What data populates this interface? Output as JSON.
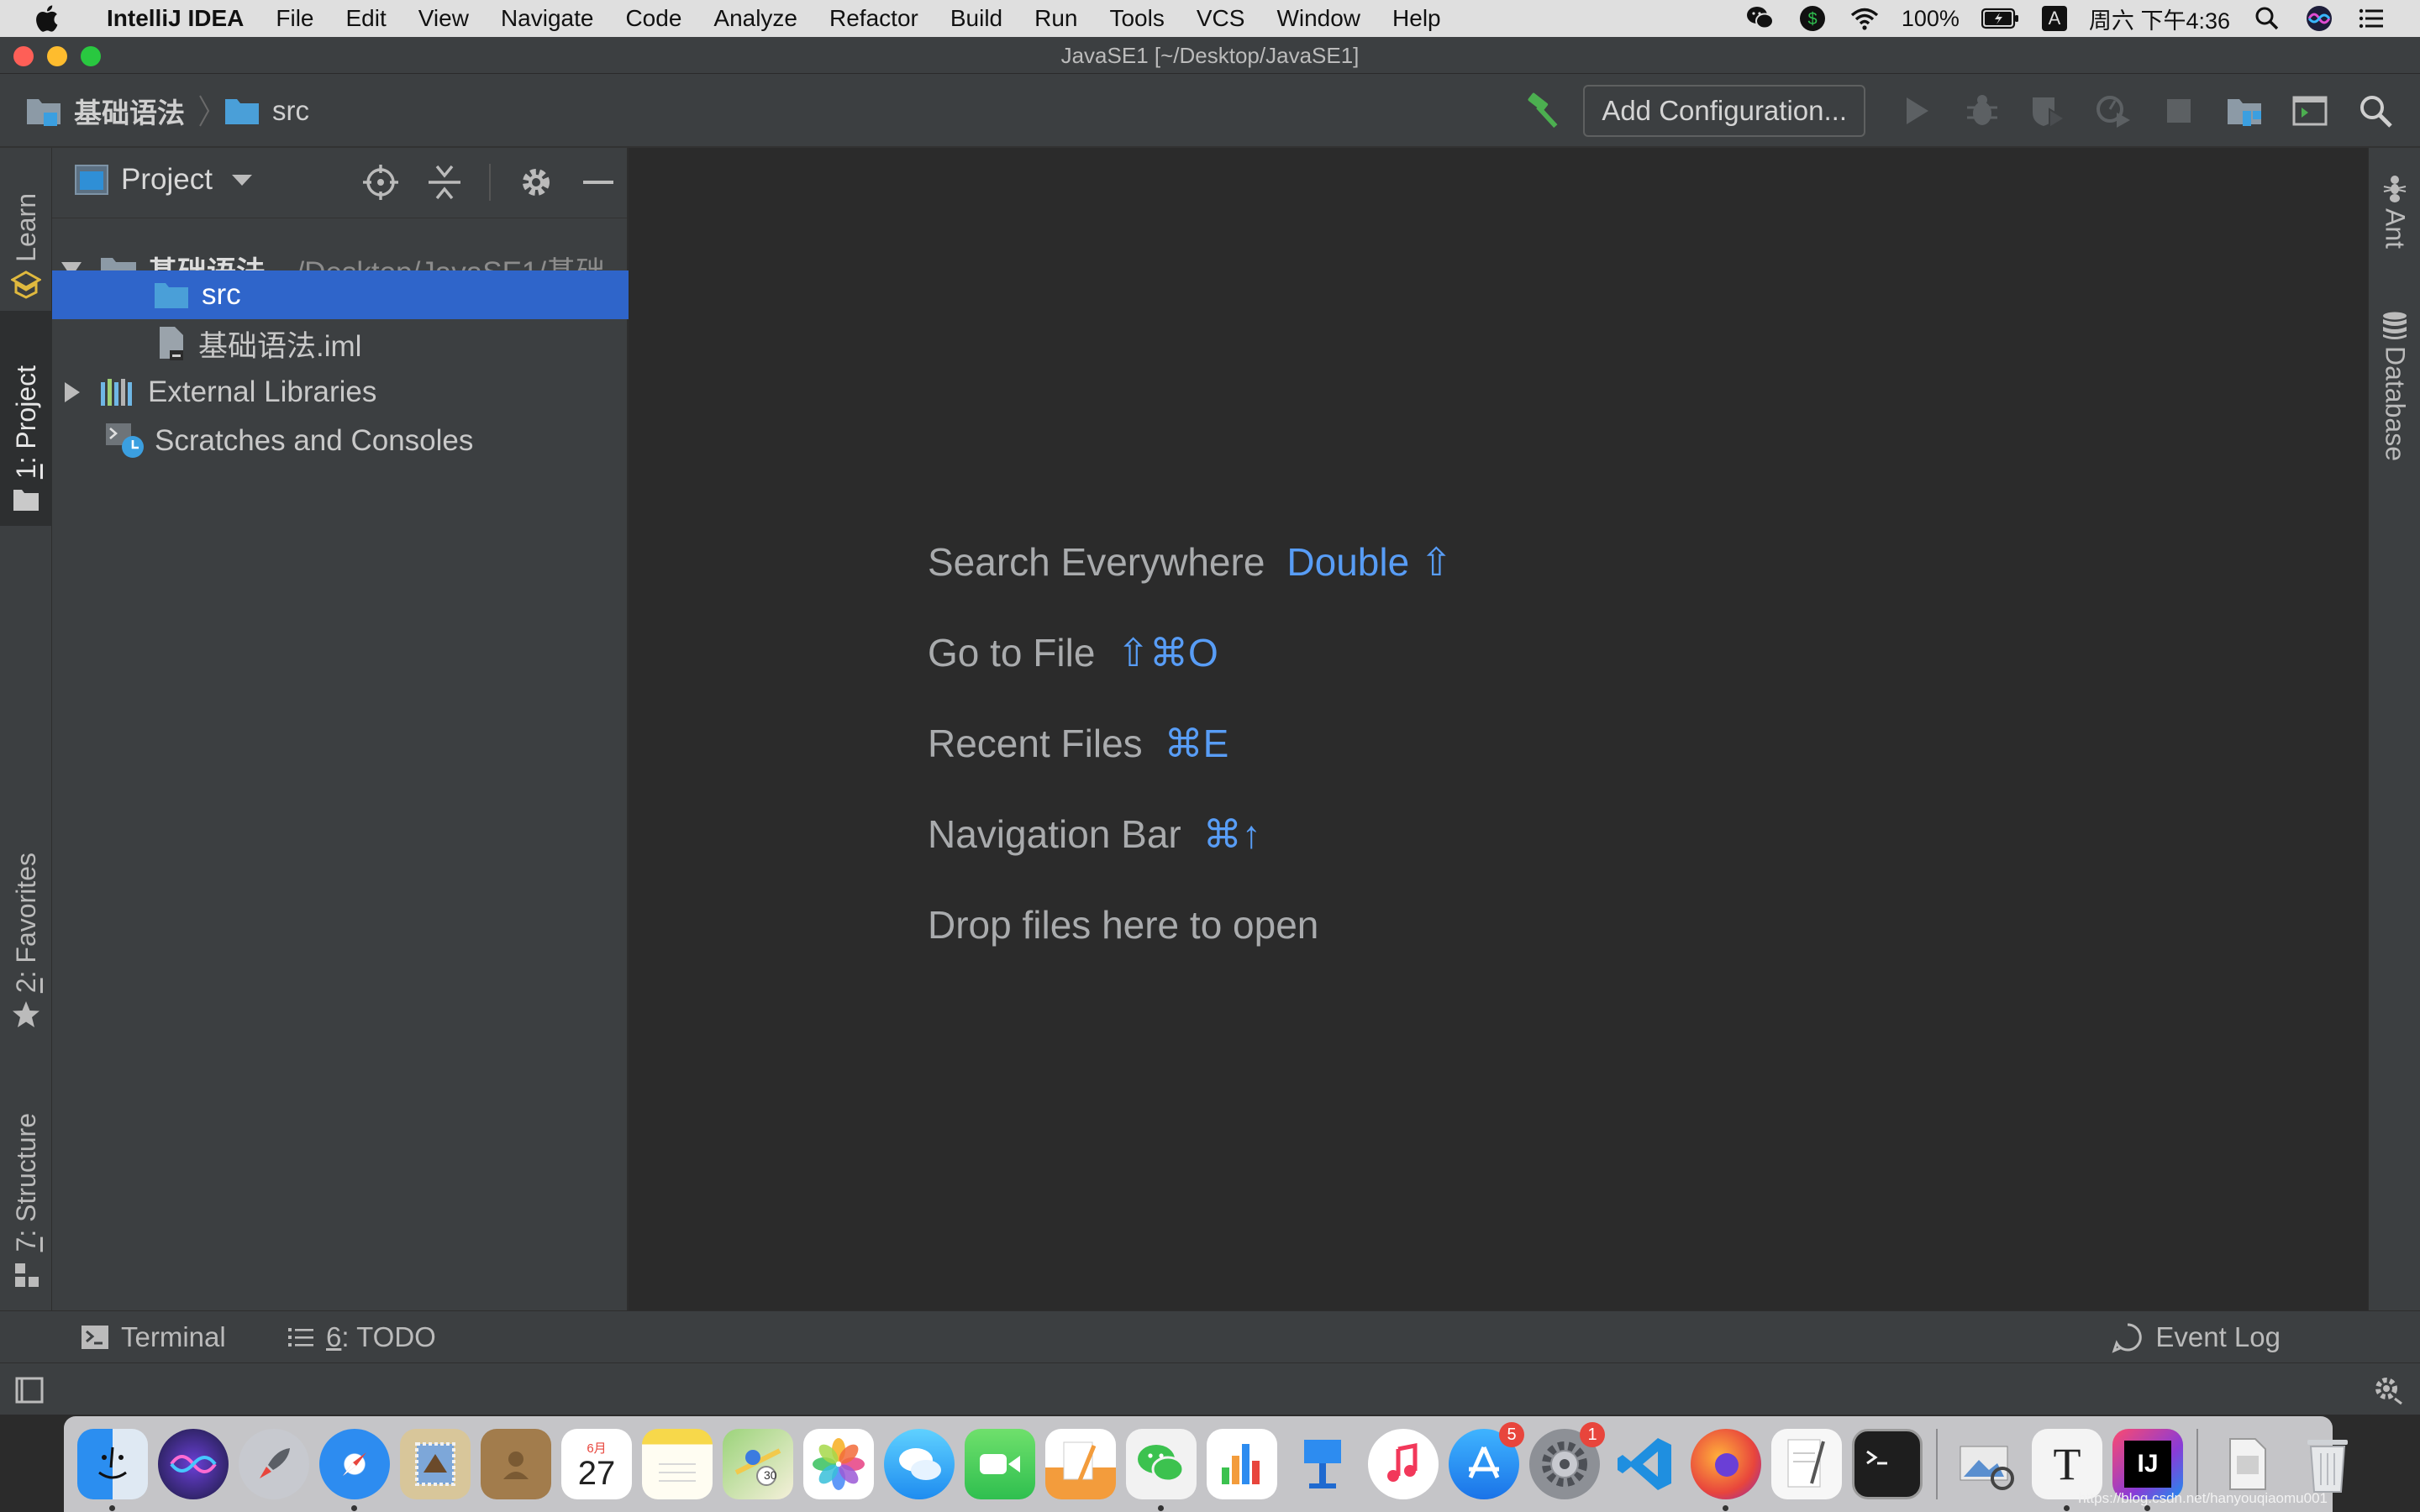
{
  "menubar": {
    "app_name": "IntelliJ IDEA",
    "items": [
      "File",
      "Edit",
      "View",
      "Navigate",
      "Code",
      "Analyze",
      "Refactor",
      "Build",
      "Run",
      "Tools",
      "VCS",
      "Window",
      "Help"
    ],
    "battery": "100%",
    "input_method": "A",
    "clock": "周六 下午4:36"
  },
  "window": {
    "title": "JavaSE1 [~/Desktop/JavaSE1]"
  },
  "navbar": {
    "crumb_project": "基础语法",
    "crumb_folder": "src",
    "add_configuration": "Add Configuration..."
  },
  "left_tabs": {
    "learn": "Learn",
    "project_num": "1",
    "project": ": Project",
    "favorites_num": "2",
    "favorites": ": Favorites",
    "structure_num": "7",
    "structure": ": Structure"
  },
  "project_panel": {
    "title": "Project",
    "root_name": "基础语法",
    "root_path": "~/Desktop/JavaSE1/基础",
    "src": "src",
    "iml": "基础语法.iml",
    "external_libraries": "External Libraries",
    "scratches": "Scratches and Consoles"
  },
  "editor_hints": [
    {
      "label": "Search Everywhere",
      "key": "Double ⇧"
    },
    {
      "label": "Go to File",
      "key": "⇧⌘O"
    },
    {
      "label": "Recent Files",
      "key": "⌘E"
    },
    {
      "label": "Navigation Bar",
      "key": "⌘↑"
    },
    {
      "label": "Drop files here to open",
      "key": ""
    }
  ],
  "right_tabs": {
    "ant": "Ant",
    "database": "Database"
  },
  "bottom_bar": {
    "terminal": "Terminal",
    "todo_num": "6",
    "todo": ": TODO",
    "event_log": "Event Log"
  },
  "dock": {
    "calendar_month": "6月",
    "calendar_day": "27",
    "maps_badge": "30",
    "appstore_badge": "5",
    "settings_badge": "1",
    "textedit_letter": "T",
    "intellij_letters": "IJ"
  },
  "watermark": "https://blog.csdn.net/hanyouqiaomu001",
  "colors": {
    "selection": "#2f65ca",
    "shortcut_key": "#589df6",
    "hint_text": "#a9abad",
    "panel_bg": "#3c3f41",
    "editor_bg": "#2b2b2b"
  }
}
